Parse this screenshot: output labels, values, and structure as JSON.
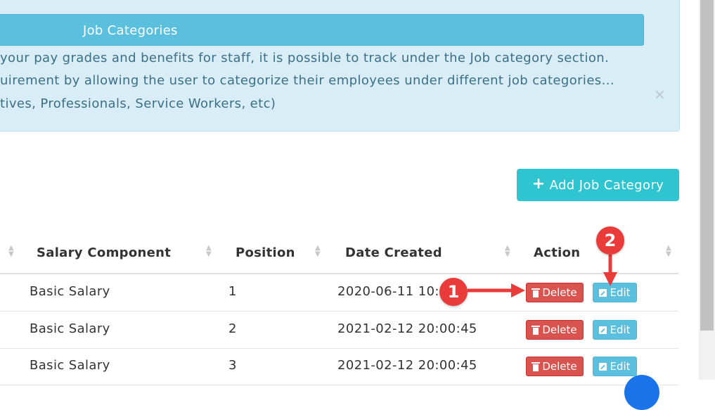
{
  "info": {
    "header": "Job Categories",
    "lines": [
      "your pay grades and benefits for staff, it is possible to track under the Job category section.",
      "uirement by allowing the user to categorize their employees under different job categories...",
      "tives, Professionals, Service Workers, etc)"
    ],
    "close_label": "×"
  },
  "add_button": {
    "label": "Add Job Category",
    "icon": "plus-icon"
  },
  "table": {
    "headers": [
      "Salary Component",
      "Position",
      "Date Created",
      "Action"
    ],
    "rows": [
      {
        "salary_component": "Basic Salary",
        "position": "1",
        "date_created": "2020-06-11 10:3",
        "delete_label": "Delete",
        "edit_label": "Edit"
      },
      {
        "salary_component": "Basic Salary",
        "position": "2",
        "date_created": "2021-02-12 20:00:45",
        "delete_label": "Delete",
        "edit_label": "Edit"
      },
      {
        "salary_component": "Basic Salary",
        "position": "3",
        "date_created": "2021-02-12 20:00:45",
        "delete_label": "Delete",
        "edit_label": "Edit"
      }
    ]
  },
  "annotations": {
    "badge1": "1",
    "badge2": "2",
    "color": "#ea3b3b"
  }
}
